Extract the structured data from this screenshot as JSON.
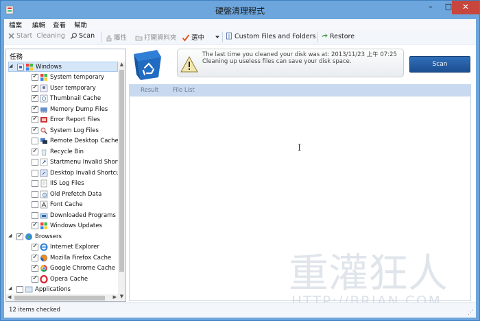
{
  "window": {
    "title": "硬盤清理程式"
  },
  "menu": [
    "檔案",
    "編輯",
    "查看",
    "幫助"
  ],
  "toolbar": {
    "start": "Start",
    "cleaning": "Cleaning",
    "scan": "Scan",
    "properties": "屬性",
    "open_folder": "打開資料夾",
    "check": "選中",
    "custom": "Custom Files and Folders",
    "restore": "Restore"
  },
  "tree": {
    "header": "任務",
    "groups": {
      "windows": "Windows",
      "browsers": "Browsers",
      "applications": "Applications"
    },
    "windows_items": [
      "System temporary",
      "User temporary",
      "Thumbnail Cache",
      "Memory Dump Files",
      "Error Report Files",
      "System Log Files",
      "Remote Desktop Cache",
      "Recycle Bin",
      "Startmenu Invalid Shortcu",
      "Desktop Invalid Shortcuts",
      "IIS Log Files",
      "Old Prefetch Data",
      "Font Cache",
      "Downloaded Programs",
      "Windows Updates"
    ],
    "browser_items": [
      "Internet Explorer",
      "Mozilla Firefox Cache",
      "Google Chrome Cache",
      "Opera Cache"
    ]
  },
  "info": {
    "line1": "The last time you cleaned your disk was at: 2013/11/23 上午 07:25",
    "line2": "Cleaning up useless files can save your disk space."
  },
  "scan_button": "Scan",
  "tabs": [
    "Result",
    "File List"
  ],
  "status": "12 items checked",
  "watermark": {
    "title": "重灌狂人",
    "url": "HTTP://BRIAN.COM"
  }
}
